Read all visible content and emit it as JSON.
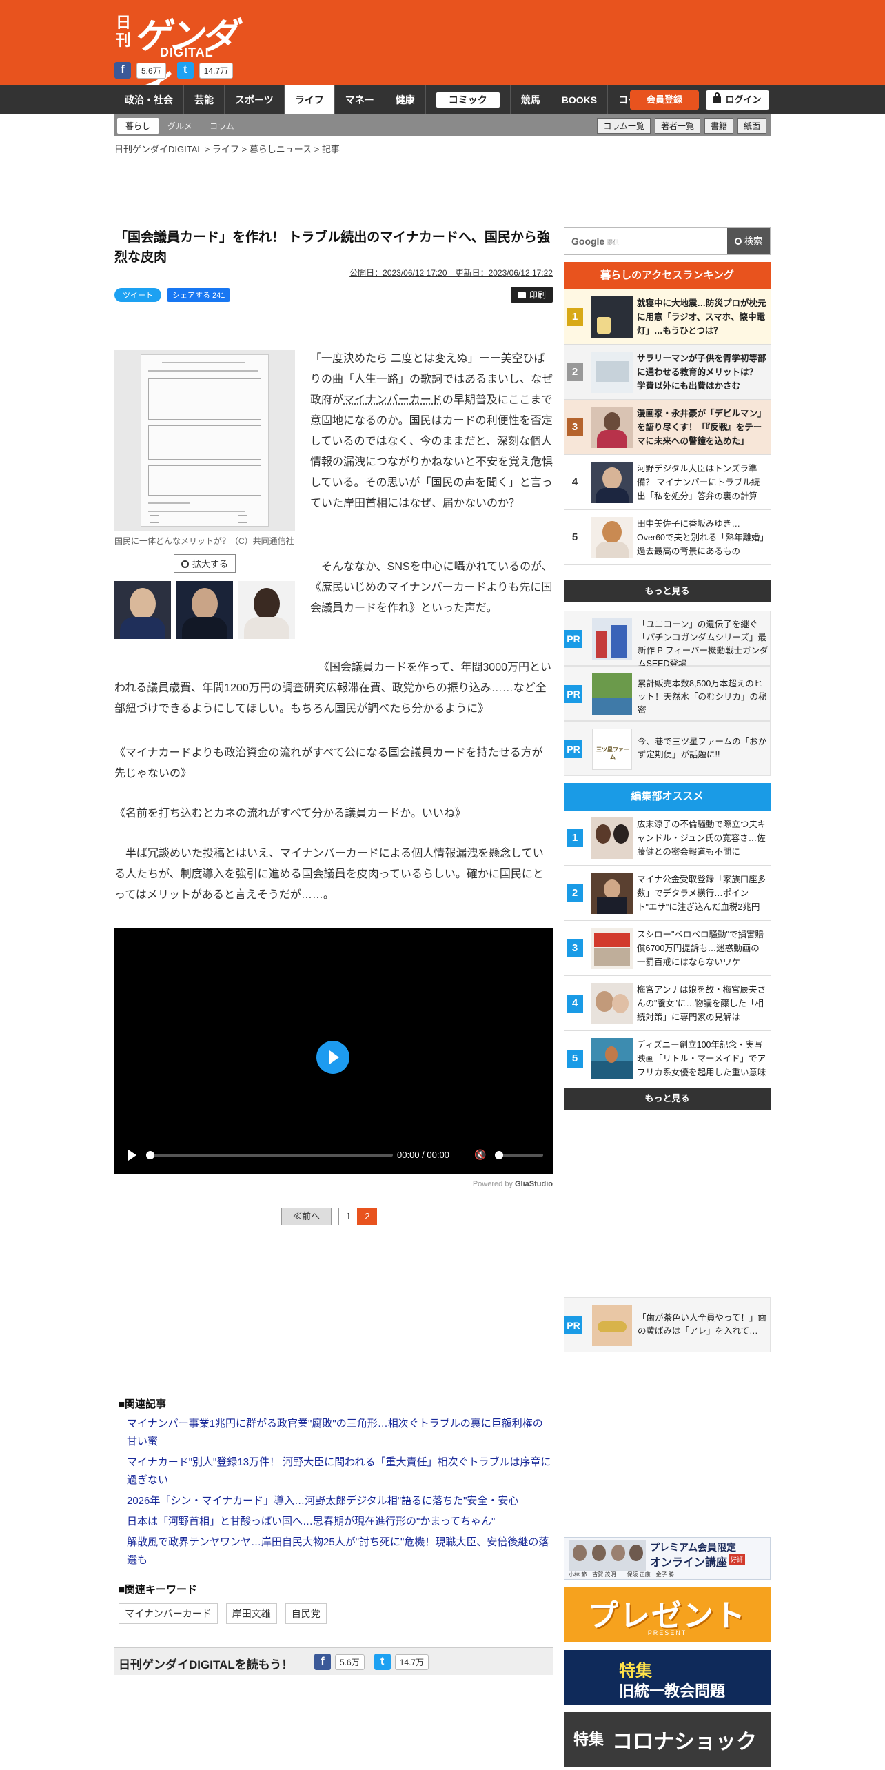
{
  "header": {
    "logo_kan": "日刊",
    "logo_main": "ゲンダイ",
    "logo_sub": "DIGITAL",
    "facebook_count": "5.6万",
    "twitter_count": "14.7万"
  },
  "nav": {
    "items": [
      "政治・社会",
      "芸能",
      "スポーツ",
      "ライフ",
      "マネー",
      "健康",
      "コミック",
      "競馬",
      "BOOKS",
      "コクハク"
    ],
    "member_label": "会員登録",
    "login_label": "ログイン"
  },
  "subnav": {
    "items": [
      "暮らし",
      "グルメ",
      "コラム"
    ],
    "buttons": [
      "コラム一覧",
      "著者一覧",
      "書籍",
      "紙面"
    ]
  },
  "breadcrumb": "日刊ゲンダイDIGITAL > ライフ > 暮らしニュース > 記事",
  "article": {
    "title": "「国会議員カード」を作れ！ トラブル続出のマイナカードへ、国民から強烈な皮肉",
    "published": "公開日：2023/06/12 17:20　更新日：2023/06/12 17:22",
    "tweet_label": "ツイート",
    "fb_share_label": "シェアする 241",
    "print_label": "印刷",
    "caption": "国民に一体どんなメリットが？（C）共同通信社",
    "zoom_label": "拡大する",
    "p1a": "「一度決めたら 二度とは変えぬ」ーー美空ひばりの曲「人生一路」の歌詞ではあるまいし、なぜ政府が",
    "p1link": "マイナンバーカード",
    "p1b": "の早期普及にここまで意固地になるのか。国民はカードの利便性を否定しているのではなく、今のままだと、深刻な個人情報の漏洩につながりかねないと不安を覚え危惧している。その思いが「国民の声を聞く」と言っていた岸田首相にはなぜ、届かないのか？",
    "p2": "そんななか、SNSを中心に囁かれているのが、《庶民いじめのマイナンバーカードよりも先に国会議員カードを作れ》といった声だ。",
    "p3": "《国会議員カードを作って、年間3000万円といわれる議員歳費、年間1200万円の調査研究広報滞在費、政党からの振り込み……など全部紐づけできるようにしてほしい。もちろん国民が調べたら分かるように》",
    "p4": "《マイナカードよりも政治資金の流れがすべて公になる国会議員カードを持たせる方が先じゃないの》",
    "p5": "《名前を打ち込むとカネの流れがすべて分かる議員カードか。いいね》",
    "p6": "半ば冗談めいた投稿とはいえ、マイナンバーカードによる個人情報漏洩を懸念している人たちが、制度導入を強引に進める国会議員を皮肉っているらしい。確かに国民にとってはメリットがあると言えそうだが……。"
  },
  "video": {
    "time": "00:00 / 00:00",
    "powered_prefix": "Powered by",
    "powered_brand": "GliaStudio"
  },
  "pager": {
    "prev": "≪前へ",
    "pages": [
      "1",
      "2"
    ]
  },
  "related": {
    "heading": "■関連記事",
    "links": [
      "マイナンバー事業1兆円に群がる政官業\"腐敗\"の三角形…相次ぐトラブルの裏に巨額利権の甘い蜜",
      "マイナカード\"別人\"登録13万件！ 河野大臣に問われる「重大責任」相次ぐトラブルは序章に過ぎない",
      "2026年「シン・マイナカード」導入…河野太郎デジタル相\"語るに落ちた\"安全・安心",
      "日本は「河野首相」と甘酸っぱい国へ…思春期が現在進行形の\"かまってちゃん\"",
      "解散風で政界テンヤワンヤ…岸田自民大物25人が\"討ち死に\"危機！現職大臣、安倍後継の落選も"
    ],
    "kw_heading": "■関連キーワード",
    "keywords": [
      "マイナンバーカード",
      "岸田文雄",
      "自民党"
    ],
    "read_label": "日刊ゲンダイDIGITALを読もう！"
  },
  "sidebar": {
    "search_brand": "Google",
    "search_provided": "提供",
    "search_button": "検索",
    "ranking_head": "暮らしのアクセスランキング",
    "ranking": [
      {
        "num": "1",
        "text": "就寝中に大地震…防災プロが枕元に用意「ラジオ、スマホ、懐中電灯」…もうひとつは？"
      },
      {
        "num": "2",
        "text": "サラリーマンが子供を青学初等部に通わせる教育的メリットは？ 学費以外にも出費はかさむ"
      },
      {
        "num": "3",
        "text": "漫画家・永井豪が「デビルマン」を語り尽くす！「『反戦』をテーマに未来への警鐘を込めた」"
      },
      {
        "num": "4",
        "text": "河野デジタル大臣はトンズラ準備？ マイナンバーにトラブル続出「私を処分」答弁の裏の計算"
      },
      {
        "num": "5",
        "text": "田中美佐子に香坂みゆき…Over60で夫と別れる「熟年離婚」過去最高の背景にあるもの"
      }
    ],
    "more_label": "もっと見る",
    "pr_badge": "PR",
    "pr": [
      "「ユニコーン」の遺伝子を継ぐ「パチンコガンダムシリーズ」最新作 P フィーバー機動戦士ガンダムSEED登場",
      "累計販売本数8,500万本超えのヒット！天然水「のむシリカ」の秘密",
      "今、巷で三ツ星ファームの「おかず定期便」が話題に!!"
    ],
    "pr_farm_label": "三ツ星ファーム",
    "editor_head": "編集部オススメ",
    "editor": [
      {
        "num": "1",
        "text": "広末涼子の不倫騒動で際立つ夫キャンドル・ジュン氏の寛容さ…佐藤健との密会報道も不問に"
      },
      {
        "num": "2",
        "text": "マイナ公金受取登録「家族口座多数」でデタラメ横行…ポイント\"エサ\"に注ぎ込んだ血税2兆円"
      },
      {
        "num": "3",
        "text": "スシロー\"ペロペロ騒動\"で損害賠償6700万円提訴も…迷惑動画の一罰百戒にはならないワケ"
      },
      {
        "num": "4",
        "text": "梅宮アンナは娘を故・梅宮辰夫さんの\"養女\"に…物議を醸した「相続対策」に専門家の見解は"
      },
      {
        "num": "5",
        "text": "ディズニー創立100年記念・実写映画「リトル・マーメイド」でアフリカ系女優を起用した重い意味"
      }
    ],
    "pr_teeth": "「歯が茶色い人全員やって！」歯の黄ばみは「アレ」を入れて…",
    "banners": {
      "seminar_title": "プレミアム会員限定",
      "seminar_sub": "オンライン講座",
      "seminar_badge": "好評",
      "seminar_names": "小林 節　古賀 茂明　　保阪 正康　金子 勝",
      "present": "プレゼント",
      "present_sub": "PRESENT",
      "tokushu1_a": "特集",
      "tokushu1_b": "旧統一教会問題",
      "tokushu2_a": "特集",
      "tokushu2_b": "コロナショック"
    }
  }
}
